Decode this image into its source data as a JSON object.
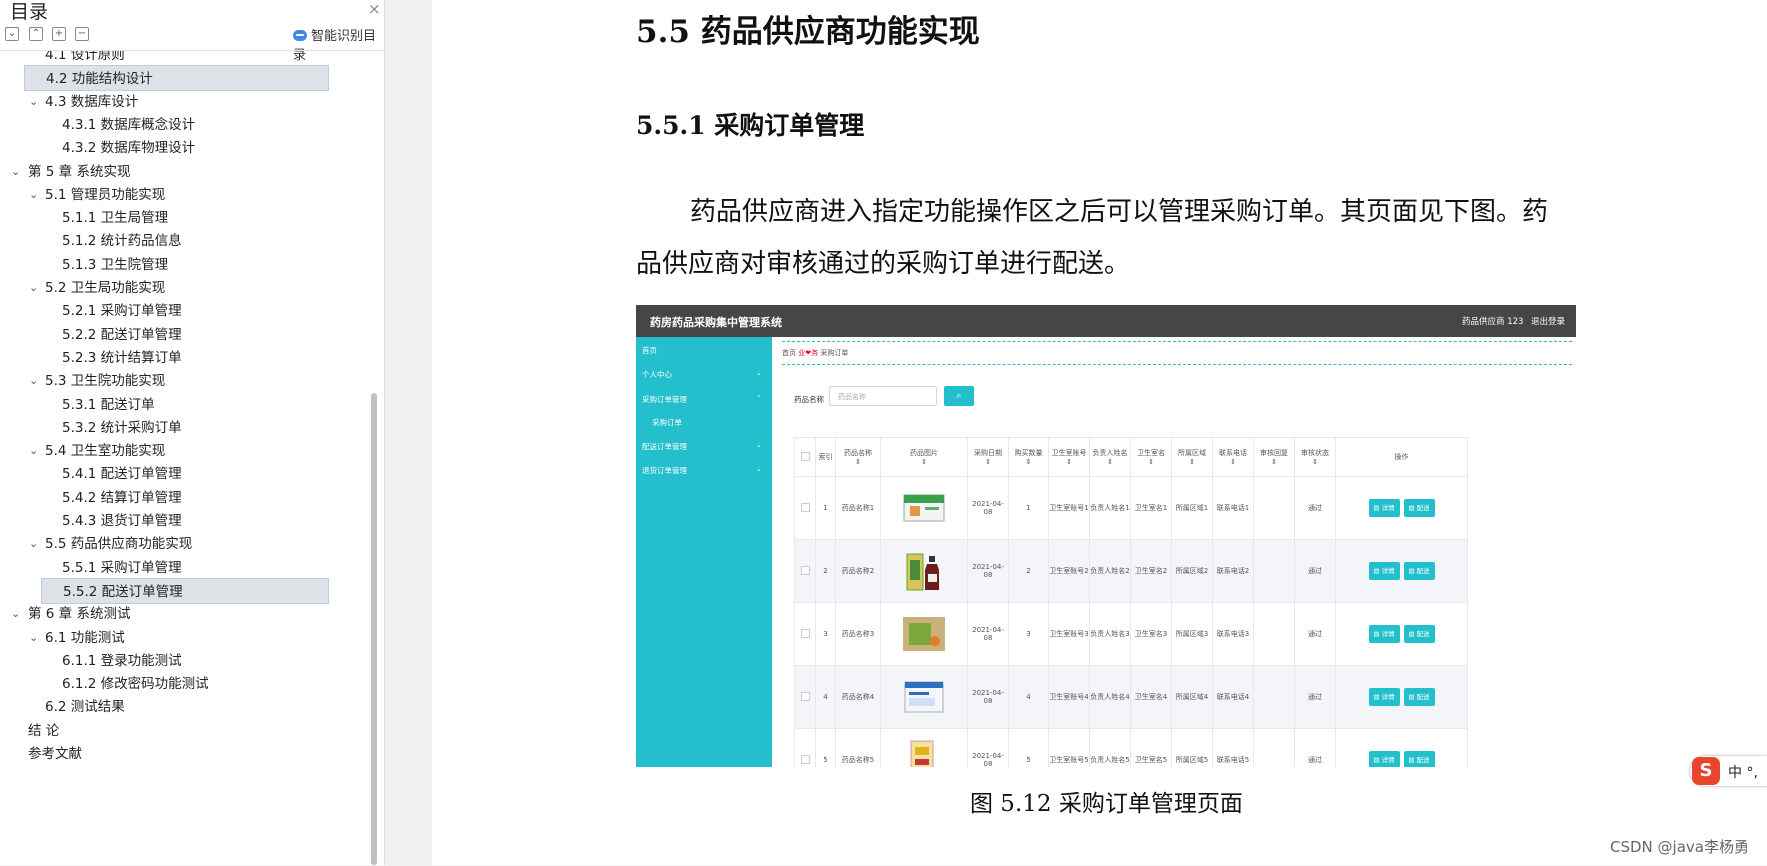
{
  "toc": {
    "title": "目录",
    "close_icon": "×",
    "toolbar": [
      "expand-all-icon",
      "collapse-all-icon",
      "add-icon",
      "remove-icon"
    ],
    "smart_label": "智能识别目录",
    "items": [
      {
        "label": "4.1  设计原则",
        "level": 2,
        "chevron": false,
        "selected": false
      },
      {
        "label": "4.2  功能结构设计",
        "level": 2,
        "chevron": false,
        "selected": true
      },
      {
        "label": "4.3  数据库设计",
        "level": 2,
        "chevron": true,
        "selected": false
      },
      {
        "label": "4.3.1  数据库概念设计",
        "level": 3,
        "chevron": false,
        "selected": false
      },
      {
        "label": "4.3.2  数据库物理设计",
        "level": 3,
        "chevron": false,
        "selected": false
      },
      {
        "label": "第 5 章  系统实现",
        "level": 1,
        "chevron": true,
        "selected": false
      },
      {
        "label": "5.1  管理员功能实现",
        "level": 2,
        "chevron": true,
        "selected": false
      },
      {
        "label": "5.1.1  卫生局管理",
        "level": 3,
        "chevron": false,
        "selected": false
      },
      {
        "label": "5.1.2  统计药品信息",
        "level": 3,
        "chevron": false,
        "selected": false
      },
      {
        "label": "5.1.3  卫生院管理",
        "level": 3,
        "chevron": false,
        "selected": false
      },
      {
        "label": "5.2  卫生局功能实现",
        "level": 2,
        "chevron": true,
        "selected": false
      },
      {
        "label": "5.2.1  采购订单管理",
        "level": 3,
        "chevron": false,
        "selected": false
      },
      {
        "label": "5.2.2  配送订单管理",
        "level": 3,
        "chevron": false,
        "selected": false
      },
      {
        "label": "5.2.3  统计结算订单",
        "level": 3,
        "chevron": false,
        "selected": false
      },
      {
        "label": "5.3  卫生院功能实现",
        "level": 2,
        "chevron": true,
        "selected": false
      },
      {
        "label": "5.3.1  配送订单",
        "level": 3,
        "chevron": false,
        "selected": false
      },
      {
        "label": "5.3.2  统计采购订单",
        "level": 3,
        "chevron": false,
        "selected": false
      },
      {
        "label": "5.4  卫生室功能实现",
        "level": 2,
        "chevron": true,
        "selected": false
      },
      {
        "label": "5.4.1  配送订单管理",
        "level": 3,
        "chevron": false,
        "selected": false
      },
      {
        "label": "5.4.2  结算订单管理",
        "level": 3,
        "chevron": false,
        "selected": false
      },
      {
        "label": "5.4.3  退货订单管理",
        "level": 3,
        "chevron": false,
        "selected": false
      },
      {
        "label": "5.5  药品供应商功能实现",
        "level": 2,
        "chevron": true,
        "selected": false
      },
      {
        "label": "5.5.1  采购订单管理",
        "level": 3,
        "chevron": false,
        "selected": false
      },
      {
        "label": "5.5.2  配送订单管理",
        "level": 3,
        "chevron": false,
        "selected": true
      },
      {
        "label": "第 6 章  系统测试",
        "level": 1,
        "chevron": true,
        "selected": false
      },
      {
        "label": "6.1  功能测试",
        "level": 2,
        "chevron": true,
        "selected": false
      },
      {
        "label": "6.1.1  登录功能测试",
        "level": 3,
        "chevron": false,
        "selected": false
      },
      {
        "label": "6.1.2  修改密码功能测试",
        "level": 3,
        "chevron": false,
        "selected": false
      },
      {
        "label": "6.2  测试结果",
        "level": 2,
        "chevron": false,
        "selected": false
      },
      {
        "label": "结    论",
        "level": 1,
        "chevron": false,
        "selected": false
      },
      {
        "label": "参考文献",
        "level": 1,
        "chevron": false,
        "selected": false
      }
    ]
  },
  "doc": {
    "h2": "5.5  药品供应商功能实现",
    "h3": "5.5.1  采购订单管理",
    "para_line1": "药品供应商进入指定功能操作区之后可以管理采购订单。其页面见下图。药",
    "para_line2": "品供应商对审核通过的采购订单进行配送。",
    "caption": "图 5.12  采购订单管理页面"
  },
  "app": {
    "title": "药房药品采购集中管理系统",
    "user": "药品供应商 123",
    "logout": "退出登录",
    "accent": "#23bfcc",
    "side": [
      {
        "label": "首页",
        "chevron": ""
      },
      {
        "label": "个人中心",
        "chevron": "⌄"
      },
      {
        "label": "采购订单管理",
        "chevron": "⌃"
      },
      {
        "label": "采购订单",
        "chevron": ""
      },
      {
        "label": "配送订单管理",
        "chevron": "⌄"
      },
      {
        "label": "退货订单管理",
        "chevron": "⌄"
      }
    ],
    "crumb_home": "首页",
    "crumb_mid": "业❤务",
    "crumb_cur": "采购订单",
    "filter_label": "药品名称",
    "filter_placeholder": "药品名称",
    "headers": [
      "索引",
      "药品名称",
      "药品图片",
      "采购日期",
      "购买数量",
      "卫生室账号",
      "负责人姓名",
      "卫生室名",
      "所属区域",
      "联系电话",
      "审核回复",
      "审核状态",
      "操作"
    ],
    "rows": [
      {
        "idx": "1",
        "name": "药品名称1",
        "date": "2021-04-08",
        "qty": "1",
        "acct": "卫生室账号1",
        "person": "负责人姓名1",
        "room": "卫生室名1",
        "area": "所属区域1",
        "phone": "联系电话1",
        "reply": "",
        "status": "通过",
        "img": "box-green"
      },
      {
        "idx": "2",
        "name": "药品名称2",
        "date": "2021-04-08",
        "qty": "2",
        "acct": "卫生室账号2",
        "person": "负责人姓名2",
        "room": "卫生室名2",
        "area": "所属区域2",
        "phone": "联系电话2",
        "reply": "",
        "status": "通过",
        "img": "bottle"
      },
      {
        "idx": "3",
        "name": "药品名称3",
        "date": "2021-04-08",
        "qty": "3",
        "acct": "卫生室账号3",
        "person": "负责人姓名3",
        "room": "卫生室名3",
        "area": "所属区域3",
        "phone": "联系电话3",
        "reply": "",
        "status": "通过",
        "img": "box-tan"
      },
      {
        "idx": "4",
        "name": "药品名称4",
        "date": "2021-04-08",
        "qty": "4",
        "acct": "卫生室账号4",
        "person": "负责人姓名4",
        "room": "卫生室名4",
        "area": "所属区域4",
        "phone": "联系电话4",
        "reply": "",
        "status": "通过",
        "img": "box-blue"
      },
      {
        "idx": "5",
        "name": "药品名称5",
        "date": "2021-04-08",
        "qty": "5",
        "acct": "卫生室账号5",
        "person": "负责人姓名5",
        "room": "卫生室名5",
        "area": "所属区域5",
        "phone": "联系电话5",
        "reply": "",
        "status": "通过",
        "img": "sachet"
      }
    ],
    "btn_detail": "详情",
    "btn_ship": "配送"
  },
  "ime": {
    "logo": "S",
    "text": "中 °,"
  },
  "watermark": "CSDN @java李杨勇"
}
